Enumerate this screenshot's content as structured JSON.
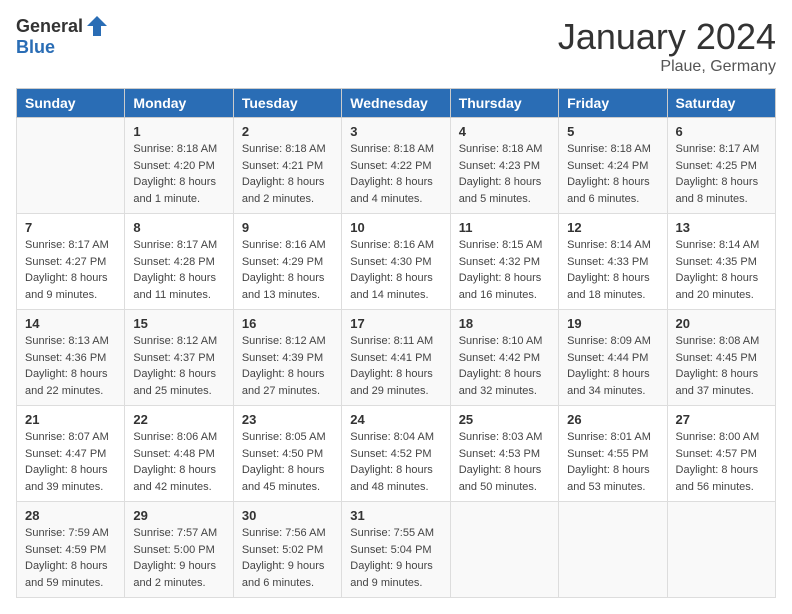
{
  "logo": {
    "text_general": "General",
    "text_blue": "Blue"
  },
  "title": "January 2024",
  "location": "Plaue, Germany",
  "days_header": [
    "Sunday",
    "Monday",
    "Tuesday",
    "Wednesday",
    "Thursday",
    "Friday",
    "Saturday"
  ],
  "weeks": [
    [
      {
        "day": "",
        "sunrise": "",
        "sunset": "",
        "daylight": ""
      },
      {
        "day": "1",
        "sunrise": "Sunrise: 8:18 AM",
        "sunset": "Sunset: 4:20 PM",
        "daylight": "Daylight: 8 hours and 1 minute."
      },
      {
        "day": "2",
        "sunrise": "Sunrise: 8:18 AM",
        "sunset": "Sunset: 4:21 PM",
        "daylight": "Daylight: 8 hours and 2 minutes."
      },
      {
        "day": "3",
        "sunrise": "Sunrise: 8:18 AM",
        "sunset": "Sunset: 4:22 PM",
        "daylight": "Daylight: 8 hours and 4 minutes."
      },
      {
        "day": "4",
        "sunrise": "Sunrise: 8:18 AM",
        "sunset": "Sunset: 4:23 PM",
        "daylight": "Daylight: 8 hours and 5 minutes."
      },
      {
        "day": "5",
        "sunrise": "Sunrise: 8:18 AM",
        "sunset": "Sunset: 4:24 PM",
        "daylight": "Daylight: 8 hours and 6 minutes."
      },
      {
        "day": "6",
        "sunrise": "Sunrise: 8:17 AM",
        "sunset": "Sunset: 4:25 PM",
        "daylight": "Daylight: 8 hours and 8 minutes."
      }
    ],
    [
      {
        "day": "7",
        "sunrise": "Sunrise: 8:17 AM",
        "sunset": "Sunset: 4:27 PM",
        "daylight": "Daylight: 8 hours and 9 minutes."
      },
      {
        "day": "8",
        "sunrise": "Sunrise: 8:17 AM",
        "sunset": "Sunset: 4:28 PM",
        "daylight": "Daylight: 8 hours and 11 minutes."
      },
      {
        "day": "9",
        "sunrise": "Sunrise: 8:16 AM",
        "sunset": "Sunset: 4:29 PM",
        "daylight": "Daylight: 8 hours and 13 minutes."
      },
      {
        "day": "10",
        "sunrise": "Sunrise: 8:16 AM",
        "sunset": "Sunset: 4:30 PM",
        "daylight": "Daylight: 8 hours and 14 minutes."
      },
      {
        "day": "11",
        "sunrise": "Sunrise: 8:15 AM",
        "sunset": "Sunset: 4:32 PM",
        "daylight": "Daylight: 8 hours and 16 minutes."
      },
      {
        "day": "12",
        "sunrise": "Sunrise: 8:14 AM",
        "sunset": "Sunset: 4:33 PM",
        "daylight": "Daylight: 8 hours and 18 minutes."
      },
      {
        "day": "13",
        "sunrise": "Sunrise: 8:14 AM",
        "sunset": "Sunset: 4:35 PM",
        "daylight": "Daylight: 8 hours and 20 minutes."
      }
    ],
    [
      {
        "day": "14",
        "sunrise": "Sunrise: 8:13 AM",
        "sunset": "Sunset: 4:36 PM",
        "daylight": "Daylight: 8 hours and 22 minutes."
      },
      {
        "day": "15",
        "sunrise": "Sunrise: 8:12 AM",
        "sunset": "Sunset: 4:37 PM",
        "daylight": "Daylight: 8 hours and 25 minutes."
      },
      {
        "day": "16",
        "sunrise": "Sunrise: 8:12 AM",
        "sunset": "Sunset: 4:39 PM",
        "daylight": "Daylight: 8 hours and 27 minutes."
      },
      {
        "day": "17",
        "sunrise": "Sunrise: 8:11 AM",
        "sunset": "Sunset: 4:41 PM",
        "daylight": "Daylight: 8 hours and 29 minutes."
      },
      {
        "day": "18",
        "sunrise": "Sunrise: 8:10 AM",
        "sunset": "Sunset: 4:42 PM",
        "daylight": "Daylight: 8 hours and 32 minutes."
      },
      {
        "day": "19",
        "sunrise": "Sunrise: 8:09 AM",
        "sunset": "Sunset: 4:44 PM",
        "daylight": "Daylight: 8 hours and 34 minutes."
      },
      {
        "day": "20",
        "sunrise": "Sunrise: 8:08 AM",
        "sunset": "Sunset: 4:45 PM",
        "daylight": "Daylight: 8 hours and 37 minutes."
      }
    ],
    [
      {
        "day": "21",
        "sunrise": "Sunrise: 8:07 AM",
        "sunset": "Sunset: 4:47 PM",
        "daylight": "Daylight: 8 hours and 39 minutes."
      },
      {
        "day": "22",
        "sunrise": "Sunrise: 8:06 AM",
        "sunset": "Sunset: 4:48 PM",
        "daylight": "Daylight: 8 hours and 42 minutes."
      },
      {
        "day": "23",
        "sunrise": "Sunrise: 8:05 AM",
        "sunset": "Sunset: 4:50 PM",
        "daylight": "Daylight: 8 hours and 45 minutes."
      },
      {
        "day": "24",
        "sunrise": "Sunrise: 8:04 AM",
        "sunset": "Sunset: 4:52 PM",
        "daylight": "Daylight: 8 hours and 48 minutes."
      },
      {
        "day": "25",
        "sunrise": "Sunrise: 8:03 AM",
        "sunset": "Sunset: 4:53 PM",
        "daylight": "Daylight: 8 hours and 50 minutes."
      },
      {
        "day": "26",
        "sunrise": "Sunrise: 8:01 AM",
        "sunset": "Sunset: 4:55 PM",
        "daylight": "Daylight: 8 hours and 53 minutes."
      },
      {
        "day": "27",
        "sunrise": "Sunrise: 8:00 AM",
        "sunset": "Sunset: 4:57 PM",
        "daylight": "Daylight: 8 hours and 56 minutes."
      }
    ],
    [
      {
        "day": "28",
        "sunrise": "Sunrise: 7:59 AM",
        "sunset": "Sunset: 4:59 PM",
        "daylight": "Daylight: 8 hours and 59 minutes."
      },
      {
        "day": "29",
        "sunrise": "Sunrise: 7:57 AM",
        "sunset": "Sunset: 5:00 PM",
        "daylight": "Daylight: 9 hours and 2 minutes."
      },
      {
        "day": "30",
        "sunrise": "Sunrise: 7:56 AM",
        "sunset": "Sunset: 5:02 PM",
        "daylight": "Daylight: 9 hours and 6 minutes."
      },
      {
        "day": "31",
        "sunrise": "Sunrise: 7:55 AM",
        "sunset": "Sunset: 5:04 PM",
        "daylight": "Daylight: 9 hours and 9 minutes."
      },
      {
        "day": "",
        "sunrise": "",
        "sunset": "",
        "daylight": ""
      },
      {
        "day": "",
        "sunrise": "",
        "sunset": "",
        "daylight": ""
      },
      {
        "day": "",
        "sunrise": "",
        "sunset": "",
        "daylight": ""
      }
    ]
  ]
}
